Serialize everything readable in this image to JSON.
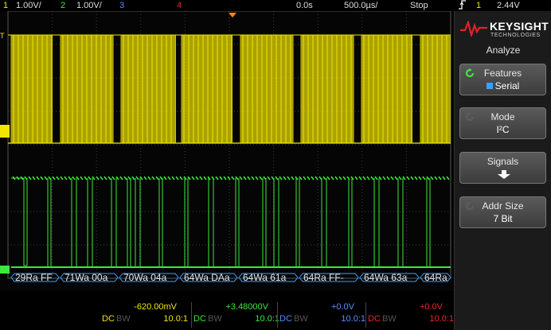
{
  "top": {
    "ch1_num": "1",
    "ch1_scale": "1.00V/",
    "ch2_num": "2",
    "ch2_scale": "1.00V/",
    "ch3_num": "3",
    "ch4_num": "4",
    "delay": "0.0s",
    "timebase": "500.0µs/",
    "run_state": "Stop",
    "trigger_icon": "rising-edge-icon",
    "trigger_source": "1",
    "trigger_level": "2.44V"
  },
  "brand": {
    "name": "KEYSIGHT",
    "tagline": "TECHNOLOGIES"
  },
  "menu": {
    "title": "Analyze",
    "features_label": "Features",
    "features_value": "Serial",
    "mode_label": "Mode",
    "mode_value": "I²C",
    "signals_label": "Signals",
    "addr_label": "Addr Size",
    "addr_value": "7 Bit"
  },
  "markers": {
    "trigger": "T",
    "ch1": "1",
    "ch2": "2"
  },
  "decode": [
    {
      "text": "29Ra FF"
    },
    {
      "text": "71Wa 00a"
    },
    {
      "text": "70Wa 04a"
    },
    {
      "text": "64Wa DAa"
    },
    {
      "text": "64Wa 61a"
    },
    {
      "text": "64Ra FF-"
    },
    {
      "text": "64Wa 63a"
    },
    {
      "text": "64Ra"
    }
  ],
  "channels": [
    {
      "offset": "-620.00mV",
      "coupling": "DC",
      "bw": "BW",
      "probe": "10.0:1",
      "color": "#f2e600"
    },
    {
      "offset": "+3.48000V",
      "coupling": "DC",
      "bw": "BW",
      "probe": "10.0:1",
      "color": "#3de83d"
    },
    {
      "offset": "+0.0V",
      "coupling": "DC",
      "bw": "BW",
      "probe": "10.0:1",
      "color": "#5a8cff"
    },
    {
      "offset": "+0.0V",
      "coupling": "DC",
      "bw": "BW",
      "probe": "10.0:1",
      "color": "#e8262e"
    }
  ],
  "colors": {
    "ch1": "#f2e600",
    "ch2": "#3de83d",
    "ch3": "#5a8cff",
    "ch4": "#e8262e",
    "decode": "#3ba0ff"
  }
}
